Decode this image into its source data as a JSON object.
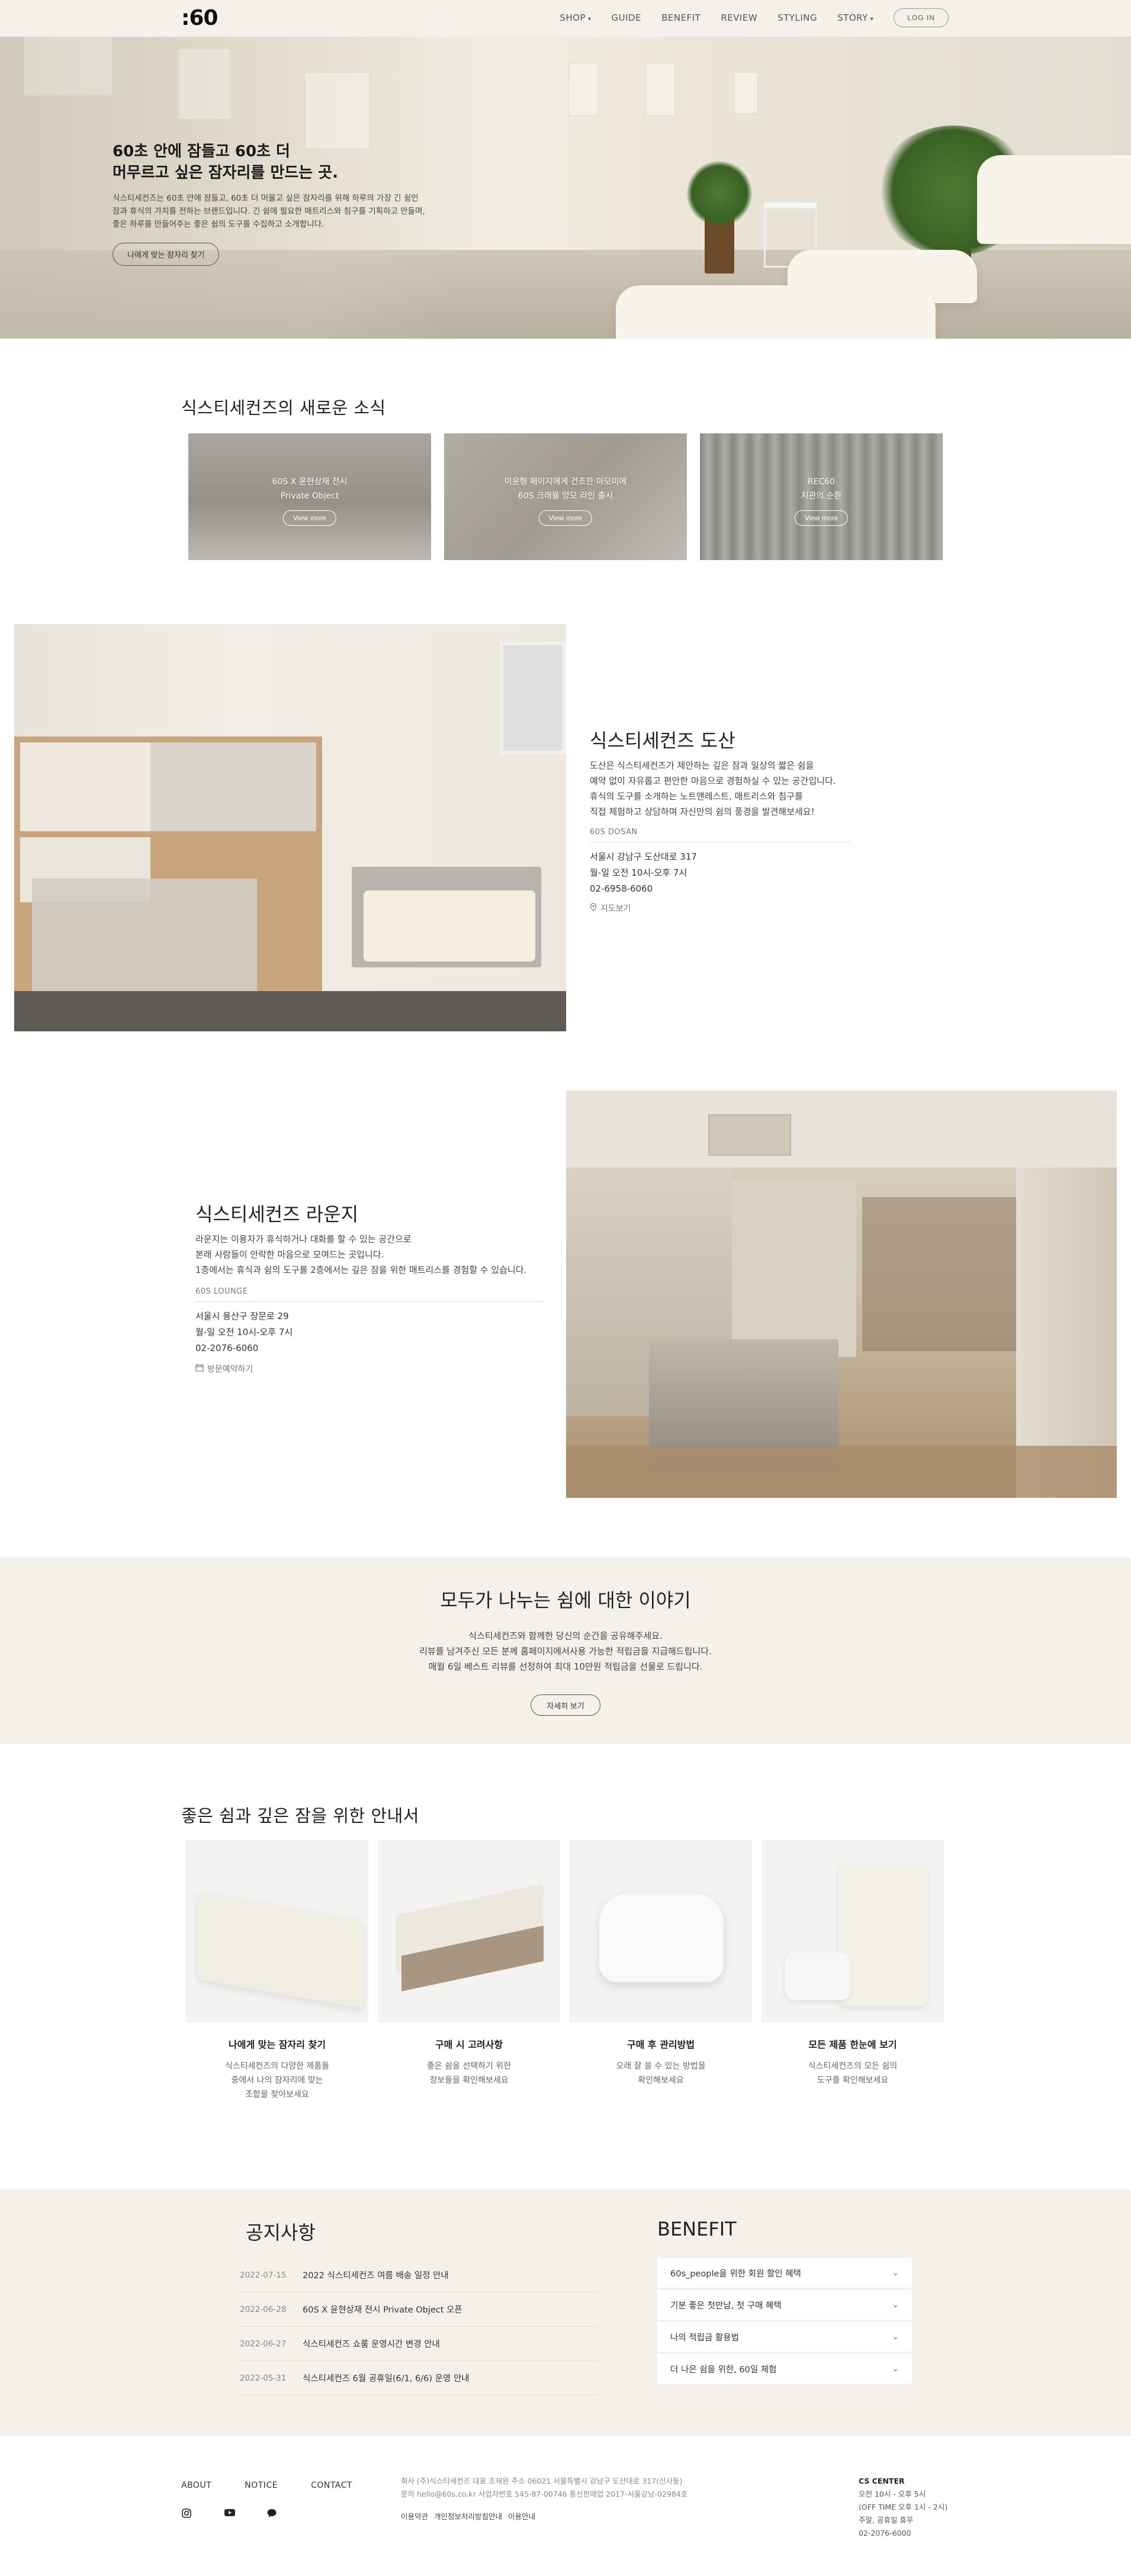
{
  "header": {
    "logo": ":60",
    "nav": [
      {
        "label": "SHOP",
        "caret": true
      },
      {
        "label": "GUIDE",
        "caret": false
      },
      {
        "label": "BENEFIT",
        "caret": false
      },
      {
        "label": "REVIEW",
        "caret": false
      },
      {
        "label": "STYLING",
        "caret": false
      },
      {
        "label": "STORY",
        "caret": true
      }
    ],
    "login": "LOG IN"
  },
  "hero": {
    "title": "60초 안에 잠들고 60초 더\n머무르고 싶은 잠자리를 만드는 곳.",
    "desc": "식스티세컨즈는 60초 안에 잠들고, 60초 더 머물고 싶은 잠자리를 위해 하루의 가장 긴 쉼인\n잠과 휴식의 가치를 전하는 브랜드입니다. 긴 쉼에 필요한 매트리스와 침구를 기획하고 만들며,\n좋은 하루를 만들어주는 좋은 쉼의 도구를 수집하고 소개합니다.",
    "button": "나에게 맞는 잠자리 찾기"
  },
  "news": {
    "title": "식스티세컨즈의 새로운 소식",
    "cards": [
      {
        "caption": "60S X 윤현상재 전시\nPrivate Object",
        "more": "View more"
      },
      {
        "caption": "이윤형 페이지에게 건조한 마모미에\n60S 크래뮬 양모 라인 출시",
        "more": "View more"
      },
      {
        "caption": "REC60\n지관의 순환",
        "more": "View more"
      }
    ]
  },
  "dosan": {
    "title": "식스티세컨즈 도산",
    "desc": "도산은 식스티세컨즈가 제안하는 깊은 잠과 일상의 짧은 쉼을\n예약 없이 자유롭고 편안한 마음으로 경험하실 수 있는 공간입니다.\n휴식의 도구를 소개하는 노트앤레스트, 매트리스와 침구를\n직접 체험하고 상담하며 자신만의 쉼의 풍경을 발견해보세요!",
    "sub": "60S DOSAN",
    "address": "서울시 강남구 도산대로 317",
    "hours": "월-일 오전 10시-오후 7시",
    "phone": "02-6958-6060",
    "link": "지도보기"
  },
  "lounge": {
    "title": "식스티세컨즈 라운지",
    "desc": "라운지는 이용자가 휴식하거나 대화를 할 수 있는 공간으로\n본래 사람들이 안락한 마음으로 모여드는 곳입니다.\n1층에서는 휴식과 쉼의 도구를 2층에서는 깊은 잠을 위한 매트리스를 경험할 수 있습니다.",
    "sub": "60S LOUNGE",
    "address": "서울시 용산구 장문로 29",
    "hours": "월-일 오전 10시-오후 7시",
    "phone": "02-2076-6060",
    "link": "방문예약하기"
  },
  "review": {
    "title": "모두가 나누는 쉼에 대한 이야기",
    "desc": "식스티세컨즈와 함께한 당신의 순간을 공유해주세요.\n리뷰를 남겨주신 모든 분께 홈페이지에서사용 가능한 적립금을 지급해드립니다.\n매월 6일 베스트 리뷰를 선정하여 최대 10만원 적립금을 선물로 드립니다.",
    "button": "자세히 보기"
  },
  "guide": {
    "title": "좋은 쉼과 깊은 잠을 위한 안내서",
    "cards": [
      {
        "title": "나에게 맞는 잠자리 찾기",
        "desc": "식스티세컨즈의 다양한 제품들\n중에서 나의 잠자리에 맞는\n조합을 찾아보세요"
      },
      {
        "title": "구매 시 고려사항",
        "desc": "좋은 쉼을 선택하기 위한\n정보들을 확인해보세요"
      },
      {
        "title": "구매 후 관리방법",
        "desc": "오래 잘 쓸 수 있는 방법을\n확인해보세요"
      },
      {
        "title": "모든 제품 한눈에 보기",
        "desc": "식스티세컨즈의 모든 쉼의\n도구를 확인해보세요"
      }
    ]
  },
  "notice": {
    "title": "공지사항",
    "items": [
      {
        "date": "2022-07-15",
        "text": "2022 식스티세컨즈 여름 배송 일정 안내"
      },
      {
        "date": "2022-06-28",
        "text": "60S X 윤현상재 전시 Private Object 오픈"
      },
      {
        "date": "2022-06-27",
        "text": "식스티세컨즈 쇼룸 운영시간 변경 안내"
      },
      {
        "date": "2022-05-31",
        "text": "식스티세컨즈 6월 공휴일(6/1, 6/6) 운영 안내"
      }
    ]
  },
  "benefit": {
    "title": "BENEFIT",
    "items": [
      "60s_people을 위한 회원 할인 혜택",
      "기분 좋은 첫만남, 첫 구매 혜택",
      "나의 적립금 활용법",
      "더 나은 쉼을 위한, 60일 체험"
    ]
  },
  "footer": {
    "nav": [
      "ABOUT",
      "NOTICE",
      "CONTACT"
    ],
    "company_line1": "회사 (주)식스티세컨즈   대표 조재완   주소 06021 서울특별시 강남구 도산대로 317(신사동)",
    "company_line2": "문의 hello@60s.co.kr   사업자번호 545-87-00746   통신판매업 2017-서울강남-02984호",
    "links": [
      "이용약관",
      "개인정보처리방침안내",
      "이용안내"
    ],
    "cs_title": "CS CENTER",
    "cs_lines": [
      "오전 10시 - 오후 5시",
      "(OFF TIME 오후 1시 - 2시)",
      "주말, 공휴일 휴무",
      "02-2076-6000"
    ]
  }
}
